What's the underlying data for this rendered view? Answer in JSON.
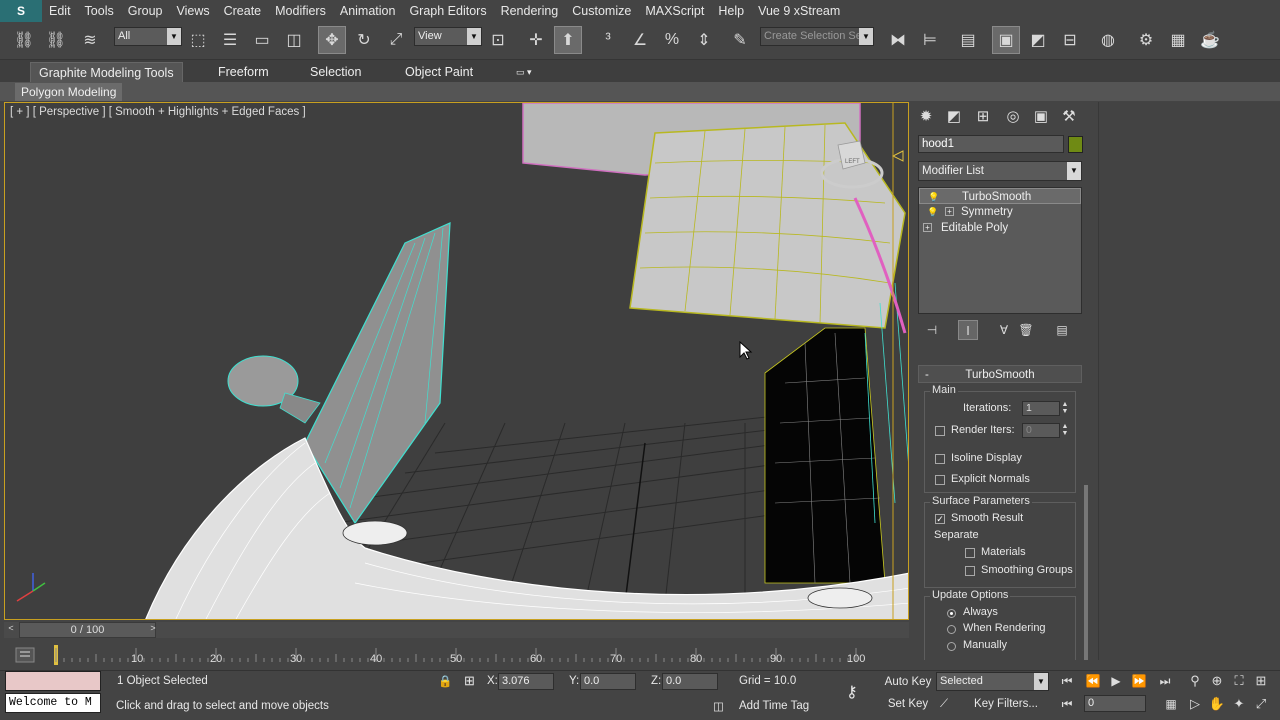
{
  "menu": {
    "items": [
      "Edit",
      "Tools",
      "Group",
      "Views",
      "Create",
      "Modifiers",
      "Animation",
      "Graph Editors",
      "Rendering",
      "Customize",
      "MAXScript",
      "Help",
      "Vue 9 xStream"
    ]
  },
  "toolbar": {
    "selection_filter": "All",
    "reference_coord": "View",
    "named_selection_placeholder": "Create Selection Se"
  },
  "ribbon": {
    "tabs": [
      "Graphite Modeling Tools",
      "Freeform",
      "Selection",
      "Object Paint"
    ],
    "panel": "Polygon Modeling"
  },
  "viewport": {
    "label": "[ + ] [ Perspective ] [ Smooth + Highlights + Edged Faces ]",
    "viewcube_label": "LEFT"
  },
  "command_panel": {
    "object_name": "hood1",
    "object_color": "#6f8a14",
    "modifier_list": "Modifier List",
    "stack": [
      {
        "label": "TurboSmooth",
        "selected": true
      },
      {
        "label": "Symmetry",
        "selected": false
      },
      {
        "label": "Editable Poly",
        "selected": false
      }
    ],
    "rollout_title": "TurboSmooth",
    "main_group": "Main",
    "iterations_label": "Iterations:",
    "iterations_value": "1",
    "render_iters_label": "Render Iters:",
    "render_iters_value": "0",
    "isoline_display": "Isoline Display",
    "explicit_normals": "Explicit Normals",
    "surface_params_group": "Surface Parameters",
    "smooth_result": "Smooth Result",
    "separate_label": "Separate",
    "materials": "Materials",
    "smoothing_groups": "Smoothing Groups",
    "update_options_group": "Update Options",
    "always": "Always",
    "when_rendering": "When Rendering",
    "manually": "Manually"
  },
  "timeline": {
    "frame_display": "0 / 100",
    "ticks": [
      "10",
      "20",
      "30",
      "40",
      "50",
      "60",
      "70",
      "80",
      "90",
      "100"
    ]
  },
  "status": {
    "listener_text": "Welcome to M",
    "selection_info": "1 Object Selected",
    "prompt": "Click and drag to select and move objects",
    "x_label": "X:",
    "x_value": "3.076",
    "y_label": "Y:",
    "y_value": "0.0",
    "z_label": "Z:",
    "z_value": "0.0",
    "grid": "Grid = 10.0",
    "add_time_tag": "Add Time Tag",
    "auto_key": "Auto Key",
    "set_key": "Set Key",
    "key_mode": "Selected",
    "key_filters": "Key Filters...",
    "current_frame": "0"
  }
}
